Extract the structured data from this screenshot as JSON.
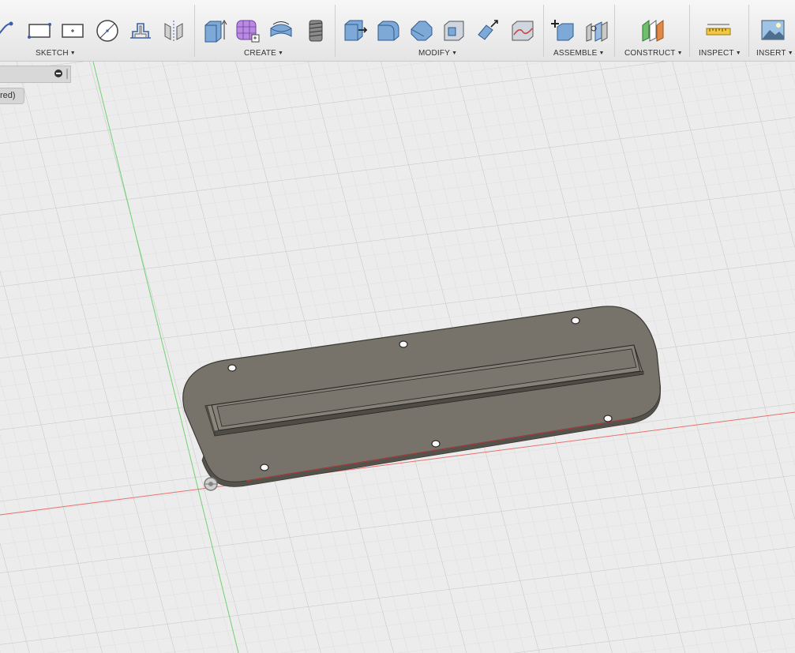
{
  "toolbar": {
    "groups": [
      {
        "label": "SKETCH"
      },
      {
        "label": "CREATE"
      },
      {
        "label": "MODIFY"
      },
      {
        "label": "ASSEMBLE"
      },
      {
        "label": "CONSTRUCT"
      },
      {
        "label": "INSPECT"
      },
      {
        "label": "INSERT"
      }
    ]
  },
  "browser": {
    "partial_label": "red)"
  },
  "colors": {
    "x_axis": "#e8706f",
    "y_axis": "#6fd36f",
    "part_face": "#77736a",
    "part_edge": "#3c3a35",
    "grid_line": "#d7d7d7",
    "background": "#ececec"
  }
}
